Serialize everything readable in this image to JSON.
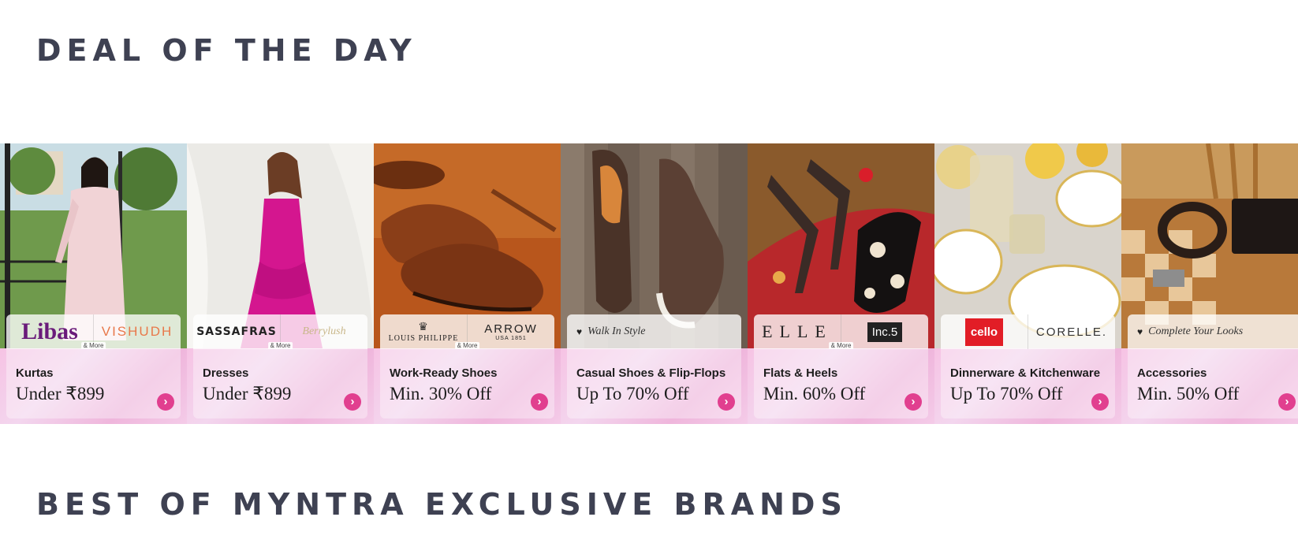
{
  "sections": {
    "deal_title": "DEAL OF THE DAY",
    "brands_title": "BEST OF MYNTRA EXCLUSIVE BRANDS"
  },
  "deals": [
    {
      "brands": [
        "Libas",
        "VISHUDH"
      ],
      "and_more": "& More",
      "category": "Kurtas",
      "offer": "Under ₹899"
    },
    {
      "brands": [
        "SASSAFRAS",
        "Berrylush"
      ],
      "and_more": "& More",
      "category": "Dresses",
      "offer": "Under ₹899"
    },
    {
      "brands": [
        "LOUIS PHILIPPE",
        "ARROW"
      ],
      "brand_sub": [
        "",
        "USA 1851"
      ],
      "and_more": "& More",
      "category": "Work-Ready Shoes",
      "offer": "Min. 30% Off"
    },
    {
      "tagline": "Walk In Style",
      "category": "Casual Shoes & Flip-Flops",
      "offer": "Up To 70% Off"
    },
    {
      "brands": [
        "ELLE",
        "Inc.5"
      ],
      "and_more": "& More",
      "category": "Flats & Heels",
      "offer": "Min. 60% Off"
    },
    {
      "brands": [
        "cello",
        "CORELLE."
      ],
      "category": "Dinnerware & Kitchenware",
      "offer": "Up To 70% Off"
    },
    {
      "tagline": "Complete Your Looks",
      "category": "Accessories",
      "offer": "Min. 50% Off"
    }
  ],
  "icons": {
    "go": "chevron-right-icon",
    "heart": "heart-icon"
  },
  "colors": {
    "title": "#3e4152",
    "accent": "#e13f8f",
    "band": "#f3c6e6"
  }
}
